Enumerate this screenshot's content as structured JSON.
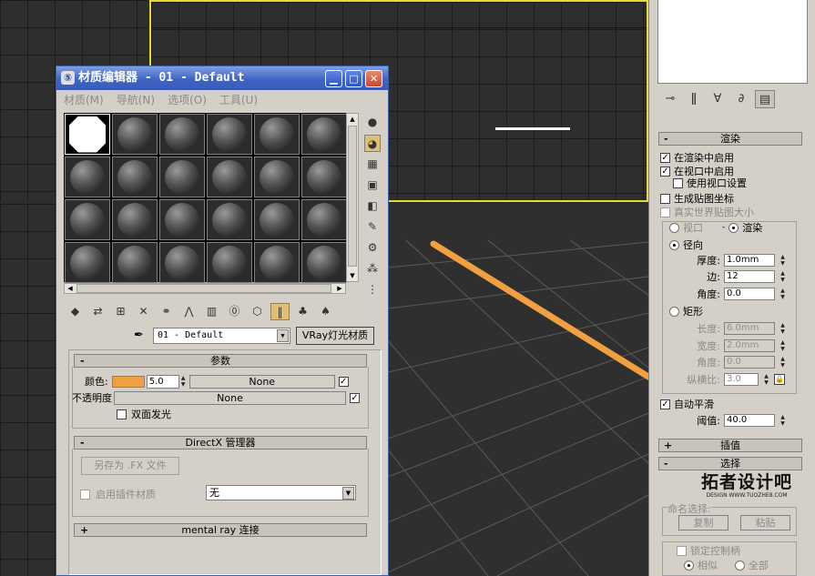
{
  "material_editor": {
    "title": "材质编辑器 - 01 - Default",
    "menu": [
      "材质(M)",
      "导航(N)",
      "选项(O)",
      "工具(U)"
    ],
    "material_name": "01 - Default",
    "material_type": "VRay灯光材质",
    "params_header": "参数",
    "color_label": "颜色:",
    "color_value": "5.0",
    "color_hex": "#f0a040",
    "color_map": "None",
    "opacity_label": "不透明度",
    "opacity_map": "None",
    "double_sided": "双面发光",
    "directx_header": "DirectX 管理器",
    "save_fx": "另存为 .FX 文件",
    "enable_plugin": "启用插件材质",
    "plugin_value": "无",
    "mental_ray_header": "mental ray 连接"
  },
  "command_panel": {
    "render_header": "渲染",
    "enable_in_render": "在渲染中启用",
    "enable_in_viewport": "在视口中启用",
    "use_viewport_settings": "使用视口设置",
    "gen_mapping_coords": "生成贴图坐标",
    "real_world_map_size": "真实世界贴图大小",
    "viewport_radio": "视口",
    "render_radio": "渲染",
    "radial": "径向",
    "thickness_label": "厚度:",
    "thickness_value": "1.0mm",
    "sides_label": "边:",
    "sides_value": "12",
    "angle_label": "角度:",
    "angle_value": "0.0",
    "rectangular": "矩形",
    "length_label": "长度:",
    "length_value": "6.0mm",
    "width_label": "宽度:",
    "width_value": "2.0mm",
    "angle2_label": "角度:",
    "angle2_value": "0.0",
    "aspect_label": "纵横比:",
    "aspect_value": "3.0",
    "auto_smooth": "自动平滑",
    "threshold_label": "阈值:",
    "threshold_value": "40.0",
    "interpolation_header": "插值",
    "selection_header": "选择",
    "logo_text": "拓者设计吧",
    "logo_sub": "DESIGN WWW.TUOZHE8.COM",
    "named_selection": "命名选择:",
    "copy": "复制",
    "paste": "粘贴",
    "lock_handles": "锁定控制柄",
    "alike": "相似",
    "all": "全部"
  }
}
